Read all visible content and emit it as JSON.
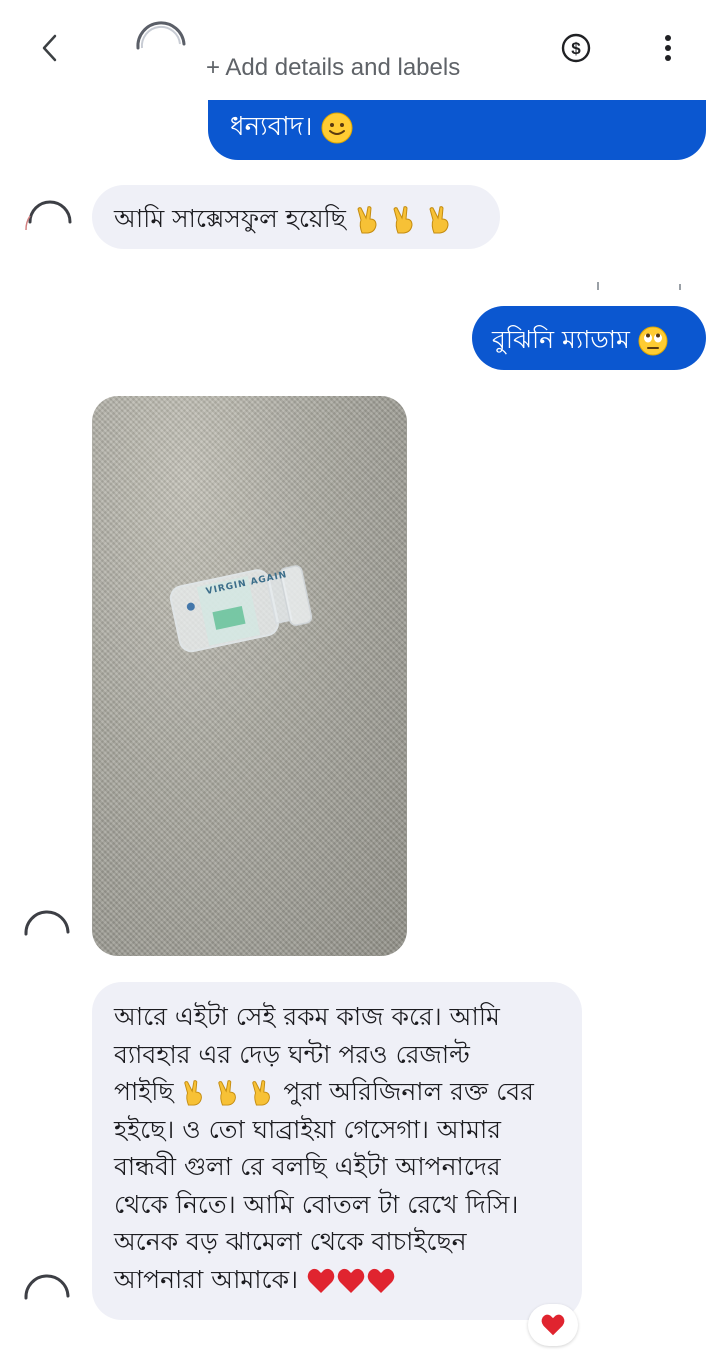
{
  "header": {
    "subtitle": "+ Add details and labels",
    "icons": {
      "back": "back-arrow-icon",
      "pay": "dollar-circle-icon",
      "more": "more-vertical-icon"
    }
  },
  "messages": [
    {
      "id": "m1",
      "direction": "outgoing",
      "text": "ধন্যবাদ।",
      "emoji": "slightly-smiling-face"
    },
    {
      "id": "m2",
      "direction": "incoming",
      "text": "আমি সাক্সেসফুল হয়েছি",
      "emoji": "victory-hand x3"
    },
    {
      "id": "m3",
      "direction": "outgoing",
      "text": "বুঝিনি ম্যাডাম",
      "emoji": "face-with-rolling-eyes"
    },
    {
      "id": "m4",
      "direction": "incoming",
      "type": "photo",
      "photo_text": "VIRGIN AGAIN"
    },
    {
      "id": "m5",
      "direction": "incoming",
      "lines": [
        "আরে এইটা সেই রকম কাজ করে। আমি",
        "ব্যাবহার এর  দেড় ঘন্টা পরও রেজাল্ট",
        "পাইছি",
        " পুরা অরিজিনাল রক্ত বের",
        "হইছে। ও তো ঘাব্রাইয়া গেসেগা। আমার",
        "বান্ধবী গুলা রে বলছি এইটা আপনাদের",
        "থেকে নিতে। আমি বোতল টা রেখে দিসি।",
        "অনেক বড় ঝামেলা থেকে বাচাইছেন",
        "আপনারা আমাকে।"
      ],
      "emoji": "red-heart x3",
      "reaction": "red-heart"
    }
  ],
  "colors": {
    "outgoing_bubble": "#0b57d0",
    "incoming_bubble": "#eff0f7",
    "header_text": "#5f6368"
  }
}
